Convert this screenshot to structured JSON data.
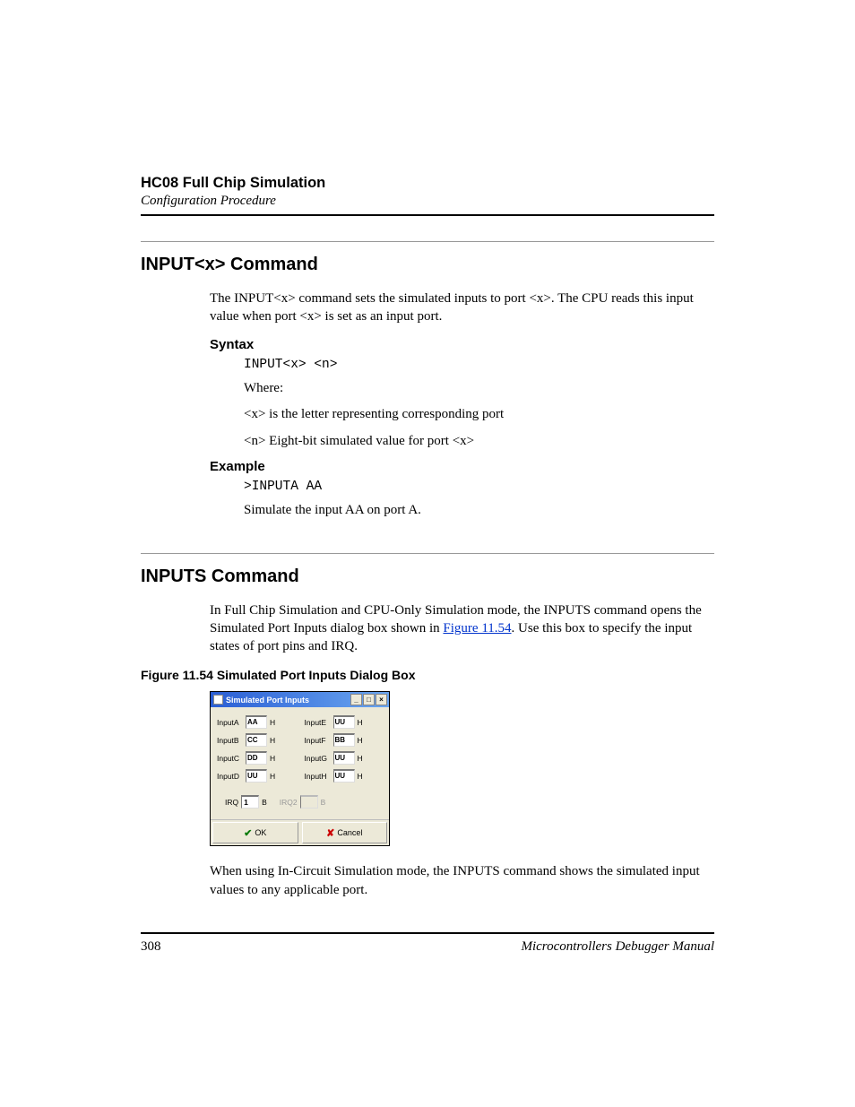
{
  "header": {
    "title": "HC08 Full Chip Simulation",
    "subtitle": "Configuration Procedure"
  },
  "section1": {
    "heading": "INPUT<x> Command",
    "intro": "The INPUT<x> command sets the simulated inputs to port <x>. The CPU reads this input value when port <x> is set as an input port.",
    "syntax_heading": "Syntax",
    "syntax_code": "INPUT<x>  <n>",
    "where_label": "Where:",
    "where_x": "<x> is the letter representing corresponding port",
    "where_n": "<n> Eight-bit simulated value for port <x>",
    "example_heading": "Example",
    "example_code": ">INPUTA AA",
    "example_desc": "Simulate the input AA on port A."
  },
  "section2": {
    "heading": "INPUTS Command",
    "intro_part1": "In Full Chip Simulation and CPU-Only Simulation mode, the INPUTS command opens the Simulated Port Inputs dialog box shown in ",
    "intro_link": "Figure 11.54",
    "intro_part2": ". Use this box to specify the input states of port pins and IRQ.",
    "figure_caption": "Figure 11.54  Simulated Port Inputs Dialog Box",
    "post_text": "When using In-Circuit Simulation mode, the INPUTS command shows the simulated input values to any applicable port."
  },
  "dialog": {
    "title": "Simulated Port Inputs",
    "inputs_left": [
      {
        "label": "InputA",
        "value": "AA",
        "suffix": "H"
      },
      {
        "label": "InputB",
        "value": "CC",
        "suffix": "H"
      },
      {
        "label": "InputC",
        "value": "DD",
        "suffix": "H"
      },
      {
        "label": "InputD",
        "value": "UU",
        "suffix": "H"
      }
    ],
    "inputs_right": [
      {
        "label": "InputE",
        "value": "UU",
        "suffix": "H"
      },
      {
        "label": "InputF",
        "value": "BB",
        "suffix": "H"
      },
      {
        "label": "InputG",
        "value": "UU",
        "suffix": "H"
      },
      {
        "label": "InputH",
        "value": "UU",
        "suffix": "H"
      }
    ],
    "irq": {
      "label": "IRQ",
      "value": "1",
      "suffix": "B"
    },
    "irq2": {
      "label": "IRQ2",
      "value": "",
      "suffix": "B"
    },
    "ok_label": "OK",
    "cancel_label": "Cancel"
  },
  "footer": {
    "page": "308",
    "manual": "Microcontrollers Debugger Manual"
  }
}
